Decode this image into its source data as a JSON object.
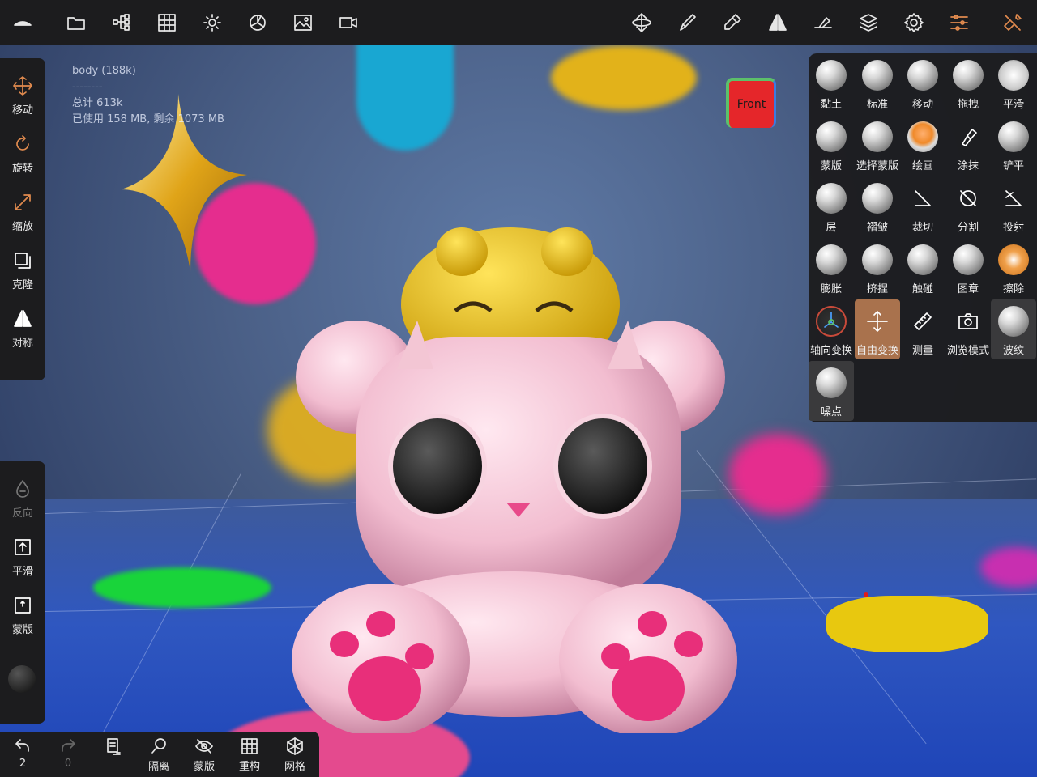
{
  "topbar": {
    "icons": [
      "nomad-logo-icon",
      "folder-icon",
      "scene-tree-icon",
      "grid-icon",
      "sun-icon",
      "material-icon",
      "image-icon",
      "camera-icon",
      "gizmo-icon",
      "brush-icon",
      "picker-icon",
      "symmetry-icon",
      "stroke-icon",
      "layers-icon",
      "settings-icon",
      "tool-settings-icon",
      "tools-icon"
    ]
  },
  "info": {
    "object": "body (188k)",
    "separator": "--------",
    "total": "总计 613k",
    "memory": "已使用 158 MB, 剩余 1073 MB"
  },
  "front_cube": {
    "label": "Front"
  },
  "left_tools": [
    {
      "label": "移动",
      "icon": "move-icon"
    },
    {
      "label": "旋转",
      "icon": "rotate-icon"
    },
    {
      "label": "缩放",
      "icon": "scale-icon"
    },
    {
      "label": "克隆",
      "icon": "clone-icon"
    },
    {
      "label": "对称",
      "icon": "symmetry-icon"
    }
  ],
  "left_options": [
    {
      "label": "反向",
      "icon": "drop-icon",
      "enabled": false
    },
    {
      "label": "平滑",
      "icon": "smooth-icon",
      "enabled": true
    },
    {
      "label": "蒙版",
      "icon": "mask-icon",
      "enabled": true
    }
  ],
  "bottom_bar": {
    "undo_count": "2",
    "redo_count": "0",
    "items": [
      {
        "label": "隔离",
        "icon": "search-icon"
      },
      {
        "label": "蒙版",
        "icon": "eye-hidden-icon"
      },
      {
        "label": "重构",
        "icon": "remesh-icon"
      },
      {
        "label": "网格",
        "icon": "mesh-icon"
      }
    ]
  },
  "brushes": [
    {
      "label": "黏土"
    },
    {
      "label": "标准"
    },
    {
      "label": "移动"
    },
    {
      "label": "拖拽"
    },
    {
      "label": "平滑"
    },
    {
      "label": "蒙版"
    },
    {
      "label": "选择蒙版"
    },
    {
      "label": "绘画"
    },
    {
      "label": "涂抹"
    },
    {
      "label": "铲平"
    },
    {
      "label": "层"
    },
    {
      "label": "褶皱"
    },
    {
      "label": "裁切"
    },
    {
      "label": "分割"
    },
    {
      "label": "投射"
    },
    {
      "label": "膨胀"
    },
    {
      "label": "挤捏"
    },
    {
      "label": "触碰"
    },
    {
      "label": "图章"
    },
    {
      "label": "擦除"
    },
    {
      "label": "轴向变换"
    },
    {
      "label": "自由变换",
      "active": true
    },
    {
      "label": "测量"
    },
    {
      "label": "浏览模式"
    },
    {
      "label": "波纹"
    },
    {
      "label": "噪点"
    }
  ],
  "colors": {
    "accent": "#e08a4e",
    "active_tool_bg": "#a9724d",
    "panel_bg": "#1c1c1e"
  }
}
